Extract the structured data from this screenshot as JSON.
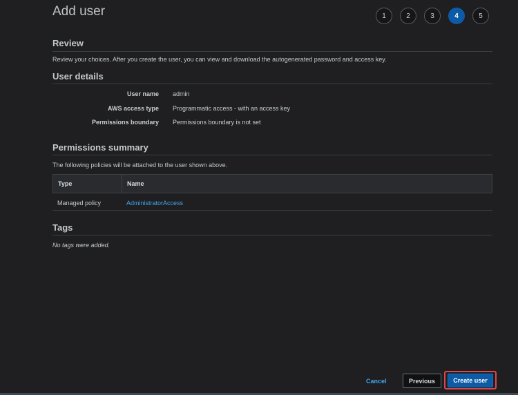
{
  "header": {
    "title": "Add user",
    "steps": [
      "1",
      "2",
      "3",
      "4",
      "5"
    ],
    "active_step": 4
  },
  "review": {
    "heading": "Review",
    "description": "Review your choices. After you create the user, you can view and download the autogenerated password and access key."
  },
  "user_details": {
    "heading": "User details",
    "rows": [
      {
        "label": "User name",
        "value": "admin"
      },
      {
        "label": "AWS access type",
        "value": "Programmatic access - with an access key"
      },
      {
        "label": "Permissions boundary",
        "value": "Permissions boundary is not set"
      }
    ]
  },
  "permissions_summary": {
    "heading": "Permissions summary",
    "description": "The following policies will be attached to the user shown above.",
    "columns": {
      "type": "Type",
      "name": "Name"
    },
    "rows": [
      {
        "type": "Managed policy",
        "name": "AdministratorAccess"
      }
    ]
  },
  "tags": {
    "heading": "Tags",
    "empty_text": "No tags were added."
  },
  "footer": {
    "cancel_label": "Cancel",
    "previous_label": "Previous",
    "create_label": "Create user"
  },
  "colors": {
    "accent": "#0d5aa7",
    "link": "#44a4e8",
    "highlight": "#e0454a"
  }
}
